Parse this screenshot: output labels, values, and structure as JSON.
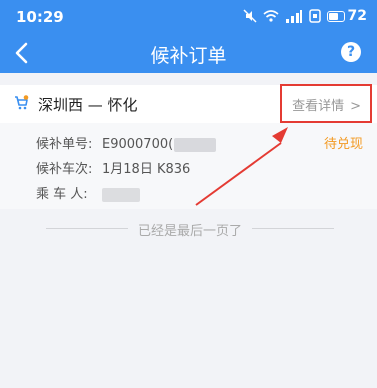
{
  "status_bar": {
    "time": "10:29",
    "battery": "72"
  },
  "header": {
    "title": "候补订单",
    "help": "?"
  },
  "order": {
    "route": "深圳西 — 怀化",
    "detail_link": "查看详情",
    "status": "待兑现",
    "rows": [
      {
        "label": "候补单号:",
        "value": "E9000700("
      },
      {
        "label": "候补车次:",
        "value": "1月18日 K836"
      },
      {
        "label": "乘 车 人:",
        "value": ""
      }
    ]
  },
  "footer": "已经是最后一页了",
  "colors": {
    "primary": "#3a8ff0",
    "highlight": "#e43b33",
    "pending": "#f39a22"
  }
}
